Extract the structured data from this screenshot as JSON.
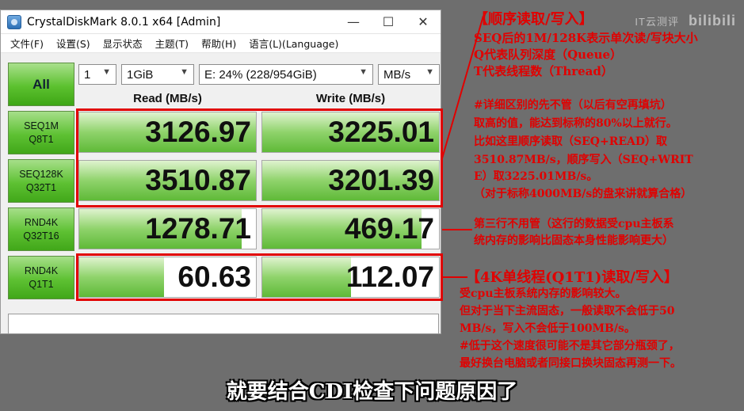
{
  "window": {
    "title": "CrystalDiskMark 8.0.1 x64 [Admin]",
    "controls": {
      "minimize": "—",
      "maximize": "☐",
      "close": "✕"
    }
  },
  "menu": [
    "文件(F)",
    "设置(S)",
    "显示状态",
    "主题(T)",
    "帮助(H)",
    "语言(L)(Language)"
  ],
  "toolbar": {
    "all_label": "All",
    "count": "1",
    "size": "1GiB",
    "drive": "E: 24% (228/954GiB)",
    "unit": "MB/s"
  },
  "columns": {
    "read": "Read (MB/s)",
    "write": "Write (MB/s)"
  },
  "tests": [
    {
      "line1": "SEQ1M",
      "line2": "Q8T1",
      "read": "3126.97",
      "write": "3225.01",
      "read_fill": 1.0,
      "write_fill": 1.0
    },
    {
      "line1": "SEQ128K",
      "line2": "Q32T1",
      "read": "3510.87",
      "write": "3201.39",
      "read_fill": 1.0,
      "write_fill": 1.0
    },
    {
      "line1": "RND4K",
      "line2": "Q32T16",
      "read": "1278.71",
      "write": "469.17",
      "read_fill": 0.92,
      "write_fill": 0.9
    },
    {
      "line1": "RND4K",
      "line2": "Q1T1",
      "read": "60.63",
      "write": "112.07",
      "read_fill": 0.48,
      "write_fill": 0.5
    }
  ],
  "annotations": {
    "seq_title": "【顺序读取/写入】",
    "seq_lines": [
      "SEQ后的1M/128K表示单次读/写块大小",
      "Q代表队列深度（Queue）",
      "T代表线程数（Thread）"
    ],
    "detail_lines": [
      "#详细区别的先不管（以后有空再填坑）",
      "取高的值，能达到标称的80%以上就行。",
      "比如这里顺序读取（SEQ+READ）取",
      "3510.87MB/s，顺序写入（SEQ+WRIT",
      "E）取3225.01MB/s。",
      "（对于标称4000MB/s的盘来讲就算合格）"
    ],
    "rnd_lines": [
      "第三行不用管（这行的数据受cpu主板系",
      "统内存的影响比固态本身性能影响更大）"
    ],
    "q1t1_title": "【4K单线程(Q1T1)读取/写入】",
    "q1t1_lines": [
      "受cpu主板系统内存的影响较大。",
      "但对于当下主流固态，一般读取不会低于50",
      "MB/s，写入不会低于100MB/s。",
      "#低于这个速度很可能不是其它部分瓶颈了，",
      "最好换台电脑或者同接口换块固态再测一下。"
    ]
  },
  "watermark": {
    "left": "IT云测评",
    "right": "bilibili"
  },
  "subtitle": "就要结合CDI检查下问题原因了",
  "colors": {
    "accent_red": "#e10000",
    "bar_green": "#5fba38",
    "button_green": "#5ec133"
  }
}
